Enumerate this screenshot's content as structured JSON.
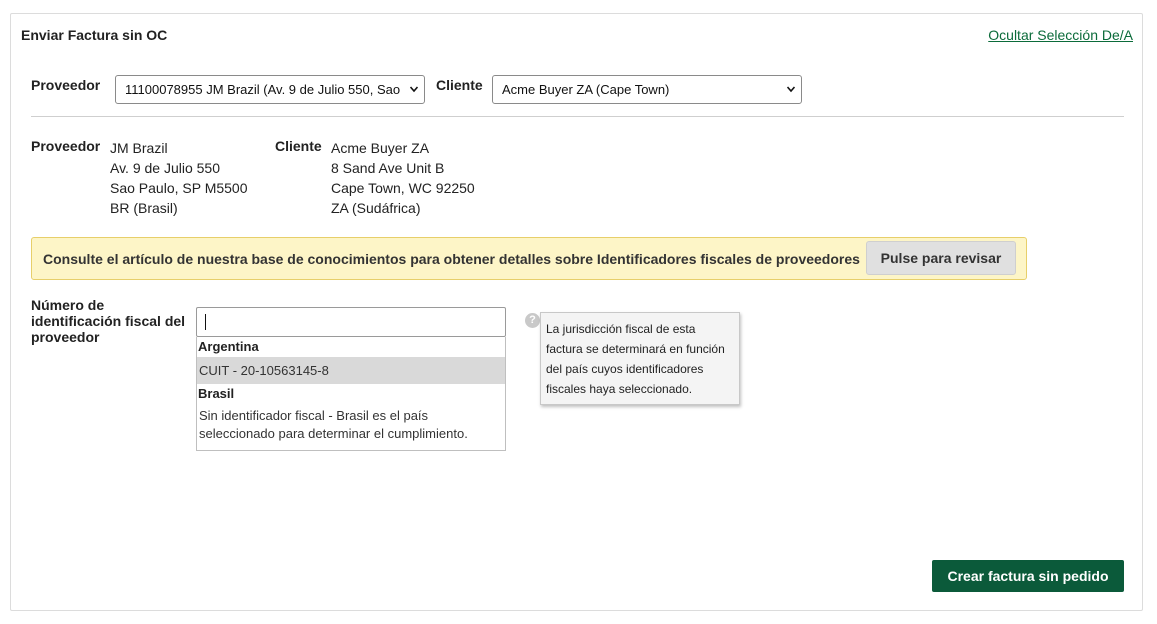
{
  "panel": {
    "title": "Enviar Factura sin OC",
    "toggle_link": "Ocultar Selección De/A"
  },
  "selection": {
    "supplier_label": "Proveedor",
    "supplier_value": "11100078955 JM Brazil (Av. 9 de Julio 550, Sao",
    "customer_label": "Cliente",
    "customer_value": "Acme Buyer ZA (Cape Town)"
  },
  "addresses": {
    "supplier_label": "Proveedor",
    "supplier_lines": [
      "JM Brazil",
      "Av. 9 de Julio 550",
      "Sao Paulo, SP M5500",
      "BR (Brasil)"
    ],
    "customer_label": "Cliente",
    "customer_lines": [
      "Acme Buyer ZA",
      "8 Sand Ave Unit B",
      "Cape Town, WC 92250",
      "ZA (Sudáfrica)"
    ]
  },
  "notice": {
    "text": "Consulte el artículo de nuestra base de conocimientos para obtener detalles sobre Identificadores fiscales de proveedores",
    "button": "Pulse para revisar"
  },
  "tax_id": {
    "label": "Número de identificación fiscal del proveedor",
    "input_value": "",
    "groups": [
      {
        "name": "Argentina",
        "options": [
          "CUIT - 20-10563145-8"
        ]
      },
      {
        "name": "Brasil",
        "options": [
          "Sin identificador fiscal - Brasil es el país seleccionado para determinar el cumplimiento."
        ]
      }
    ],
    "help_glyph": "?",
    "tooltip": "La jurisdicción fiscal de esta factura se determinará en función del país cuyos identificadores fiscales haya seleccionado."
  },
  "actions": {
    "create_button": "Crear factura sin pedido"
  },
  "colors": {
    "accent_green": "#0b5a3a",
    "link_green": "#0b6b3a",
    "notice_bg": "#fdf5c7"
  }
}
